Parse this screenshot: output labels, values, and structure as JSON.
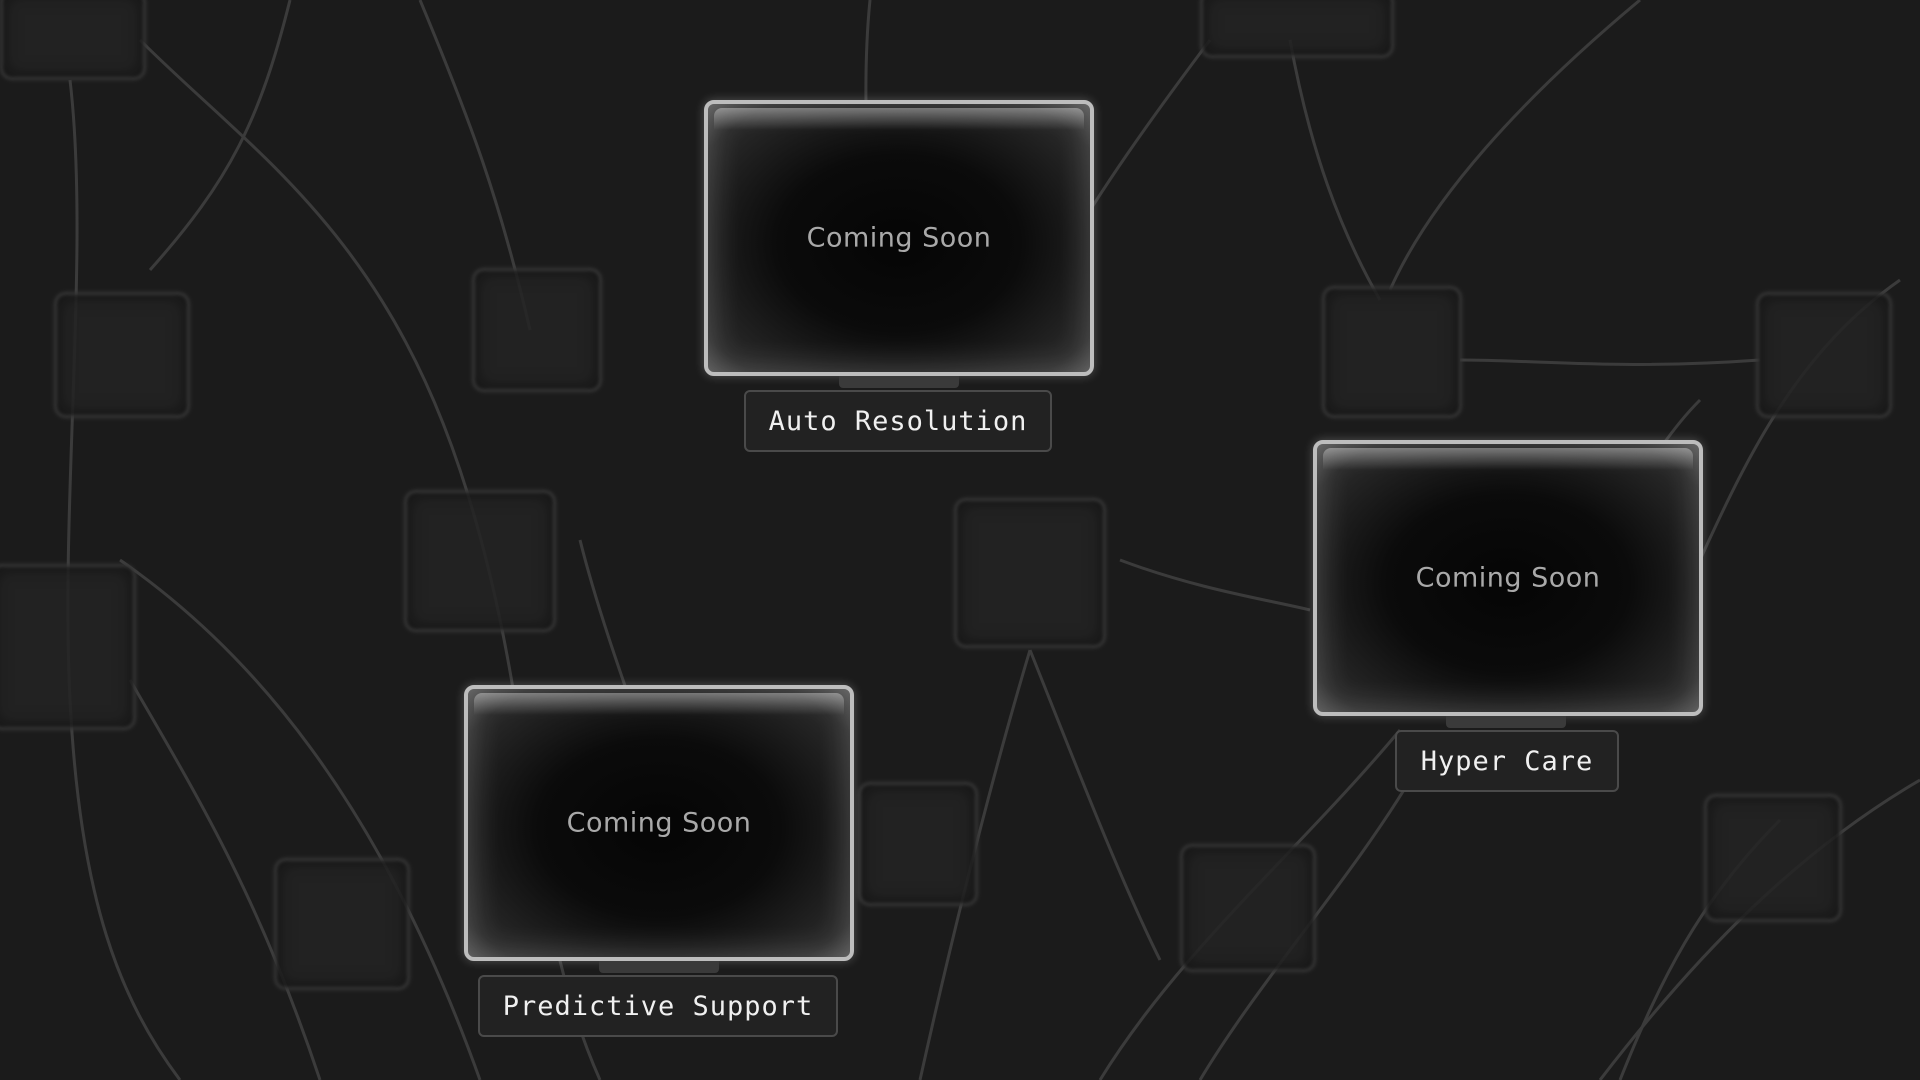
{
  "cards": [
    {
      "status": "Coming Soon",
      "label": "Auto Resolution"
    },
    {
      "status": "Coming Soon",
      "label": "Hyper Care"
    },
    {
      "status": "Coming Soon",
      "label": "Predictive Support"
    }
  ],
  "colors": {
    "background": "#1b1b1b",
    "card_border": "#bdbdbd",
    "label_text": "#f0f0f0",
    "card_text": "#a9a9a9"
  }
}
